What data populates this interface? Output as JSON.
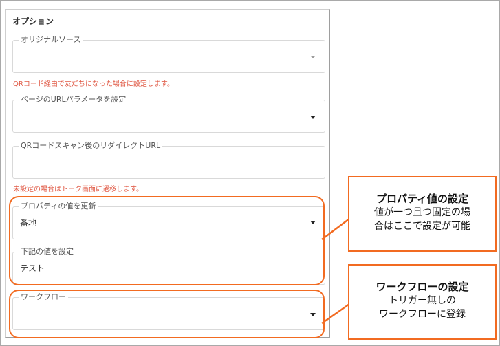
{
  "section": {
    "title": "オプション"
  },
  "original_source": {
    "label": "オリジナルソース",
    "value": ""
  },
  "original_source_hint": "QRコード経由で友だちになった場合に設定します。",
  "url_param": {
    "label": "ページのURLパラメータを設定",
    "value": ""
  },
  "redirect_url": {
    "label": "QRコードスキャン後のリダイレクトURL",
    "value": ""
  },
  "redirect_url_hint": "未設定の場合はトーク画面に遷移します。",
  "property_update": {
    "label": "プロパティの値を更新",
    "value": "番地"
  },
  "property_value": {
    "label": "下記の値を設定",
    "value": "テスト"
  },
  "workflow": {
    "label": "ワークフロー",
    "value": ""
  },
  "callout_property": {
    "title": "プロパティ値の設定",
    "line1": "値が一つ且つ固定の場",
    "line2": "合はここで設定が可能"
  },
  "callout_workflow": {
    "title": "ワークフローの設定",
    "line1": "トリガー無しの",
    "line2": "ワークフローに登録"
  },
  "colors": {
    "accent": "#f26b21",
    "hint": "#e05a46",
    "border": "#d9d9d9"
  }
}
